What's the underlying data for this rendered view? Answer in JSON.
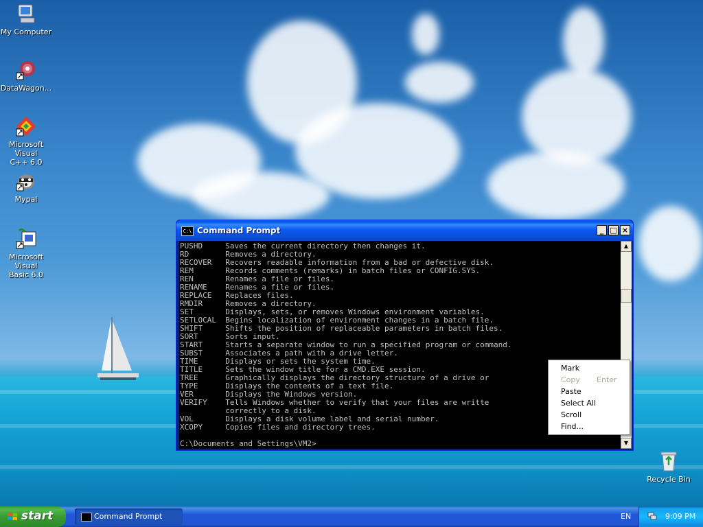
{
  "desktop": {
    "icons": [
      {
        "label_lines": [
          "My Computer"
        ],
        "icon": "my-computer-icon"
      },
      {
        "label_lines": [
          "DataWagon..."
        ],
        "icon": "datawagon-icon"
      },
      {
        "label_lines": [
          "Microsoft Visual",
          "C++ 6.0"
        ],
        "icon": "visual-cpp-icon"
      },
      {
        "label_lines": [
          "Mypal"
        ],
        "icon": "mypal-icon"
      },
      {
        "label_lines": [
          "Microsoft Visual",
          "Basic 6.0"
        ],
        "icon": "visual-basic-icon"
      },
      {
        "label_lines": [
          "Recycle Bin"
        ],
        "icon": "recycle-bin-icon"
      }
    ]
  },
  "cmd_window": {
    "title": "Command Prompt",
    "icon_text": "C:\\",
    "controls": {
      "minimize": "_",
      "maximize": "□",
      "close": "×"
    },
    "lines": [
      "PUSHD     Saves the current directory then changes it.",
      "RD        Removes a directory.",
      "RECOVER   Recovers readable information from a bad or defective disk.",
      "REM       Records comments (remarks) in batch files or CONFIG.SYS.",
      "REN       Renames a file or files.",
      "RENAME    Renames a file or files.",
      "REPLACE   Replaces files.",
      "RMDIR     Removes a directory.",
      "SET       Displays, sets, or removes Windows environment variables.",
      "SETLOCAL  Begins localization of environment changes in a batch file.",
      "SHIFT     Shifts the position of replaceable parameters in batch files.",
      "SORT      Sorts input.",
      "START     Starts a separate window to run a specified program or command.",
      "SUBST     Associates a path with a drive letter.",
      "TIME      Displays or sets the system time.",
      "TITLE     Sets the window title for a CMD.EXE session.",
      "TREE      Graphically displays the directory structure of a drive or",
      "TYPE      Displays the contents of a text file.",
      "VER       Displays the Windows version.",
      "VERIFY    Tells Windows whether to verify that your files are writte",
      "          correctly to a disk.",
      "VOL       Displays a disk volume label and serial number.",
      "XCOPY     Copies files and directory trees.",
      "",
      "C:\\Documents and Settings\\VM2>"
    ]
  },
  "context_menu": {
    "items": [
      {
        "label": "Mark",
        "shortcut": "",
        "disabled": false
      },
      {
        "label": "Copy",
        "shortcut": "Enter",
        "disabled": true
      },
      {
        "label": "Paste",
        "shortcut": "",
        "disabled": false
      },
      {
        "label": "Select All",
        "shortcut": "",
        "disabled": false
      },
      {
        "label": "Scroll",
        "shortcut": "",
        "disabled": false
      },
      {
        "label": "Find...",
        "shortcut": "",
        "disabled": false
      }
    ]
  },
  "taskbar": {
    "start_label": "start",
    "tasks": [
      {
        "label": "Command Prompt"
      }
    ],
    "language": "EN",
    "clock": "9:09 PM"
  },
  "colors": {
    "console_text": "#c0c0c0",
    "console_bg": "#000000",
    "title_bar": "#0a5cf3",
    "taskbar": "#2157d7",
    "start_button": "#3a9a33"
  }
}
